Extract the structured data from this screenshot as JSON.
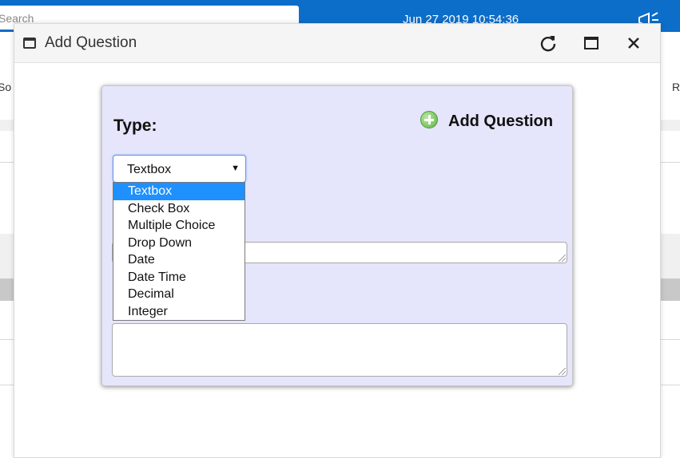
{
  "background": {
    "search_placeholder": "Search",
    "datetime": "Jun 27 2019 10:54:36",
    "left_text": "So",
    "right_text": "R"
  },
  "window": {
    "title": "Add Question",
    "icons": {
      "window": "window-icon",
      "refresh": "refresh-icon",
      "maximize": "maximize-icon",
      "close": "close-icon"
    }
  },
  "form": {
    "type_label": "Type:",
    "add_question_label": "Add Question",
    "select_value": "Textbox",
    "options": [
      "Textbox",
      "Check Box",
      "Multiple Choice",
      "Drop Down",
      "Date",
      "Date Time",
      "Decimal",
      "Integer"
    ],
    "highlighted_option": "Textbox"
  },
  "colors": {
    "topbar": "#0d6ec9",
    "panel": "#e5e5fb",
    "highlight": "#1e90ff",
    "add_icon": "#5fb444"
  }
}
